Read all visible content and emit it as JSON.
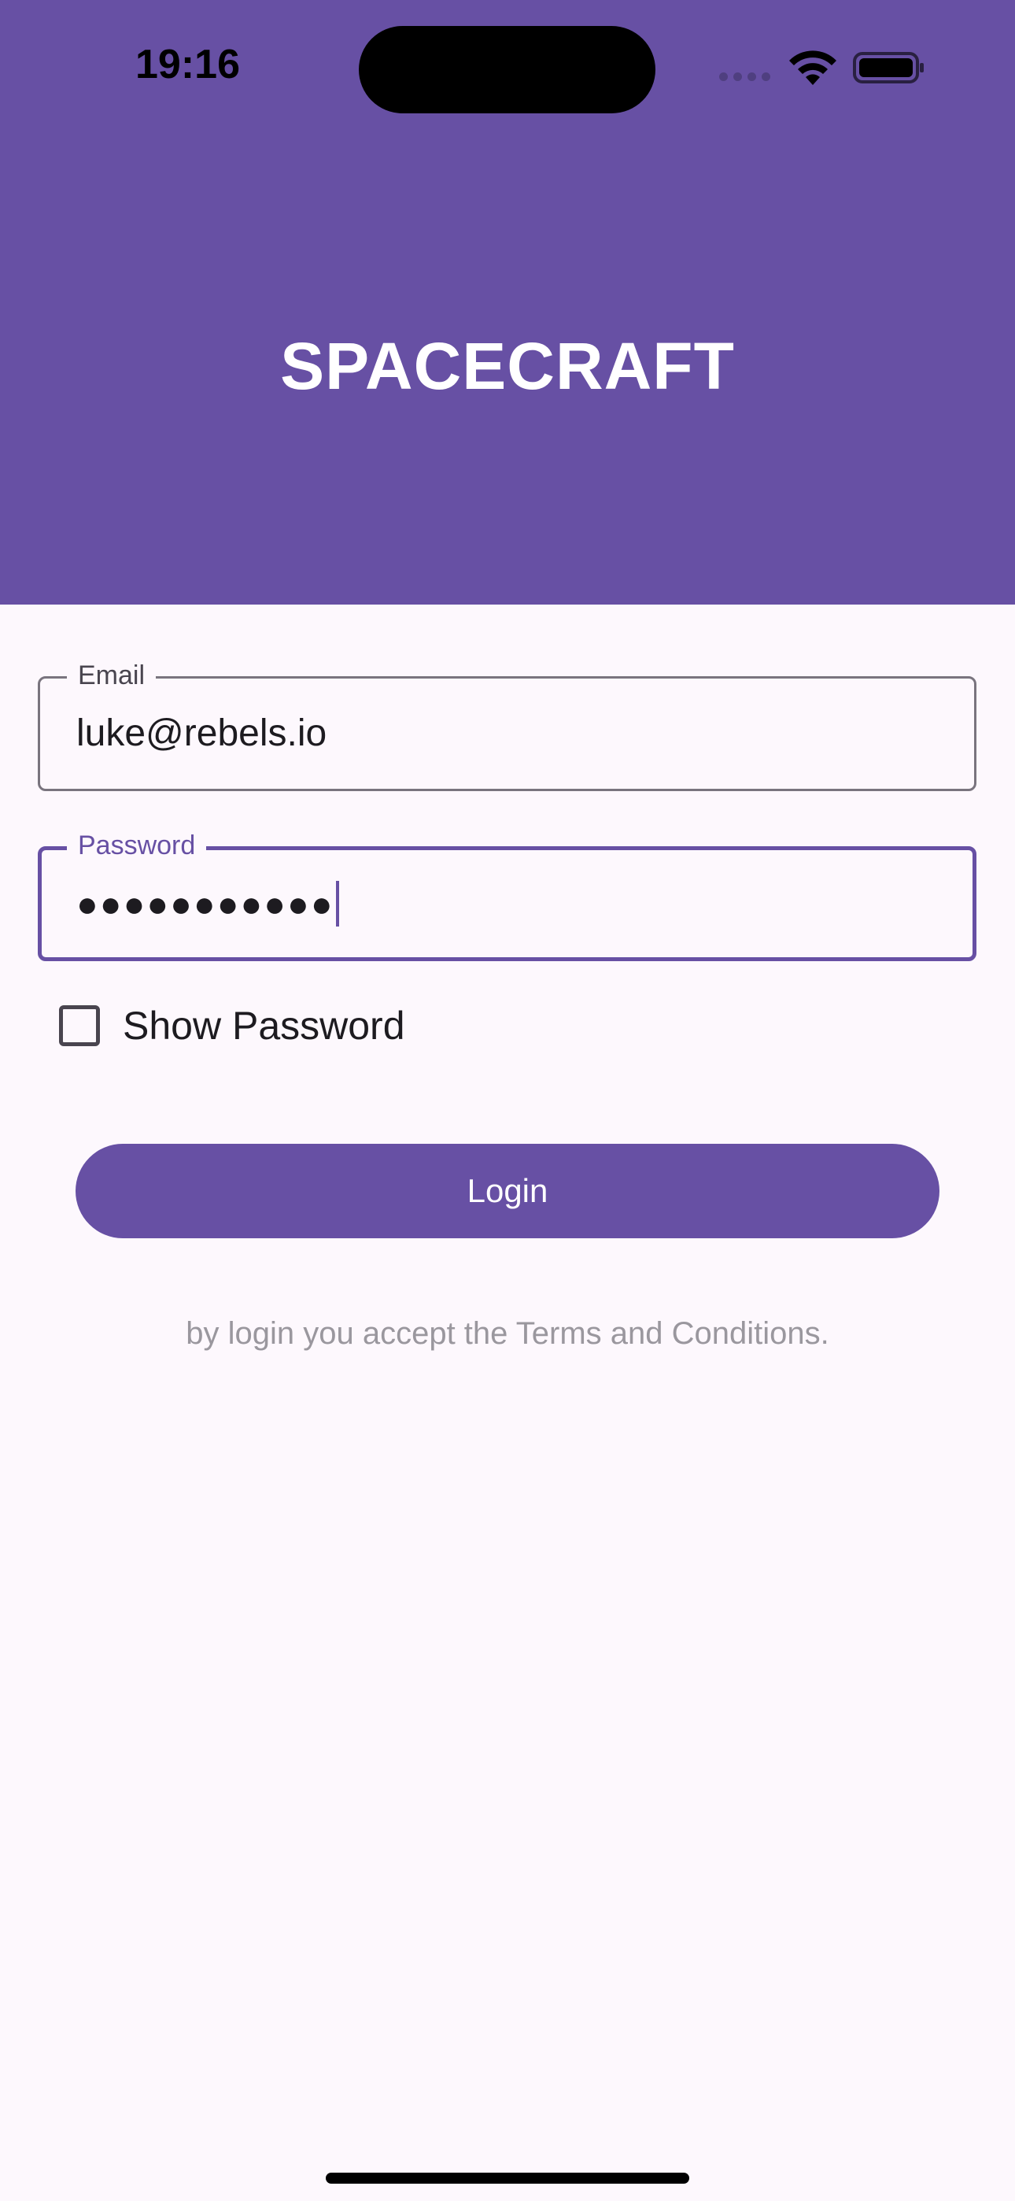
{
  "status_bar": {
    "time": "19:16"
  },
  "header": {
    "title": "SPACECRAFT",
    "color": "#6750A4"
  },
  "form": {
    "email": {
      "label": "Email",
      "value": "luke@rebels.io"
    },
    "password": {
      "label": "Password",
      "value": "●●●●●●●●●●●"
    },
    "show_password": {
      "label": "Show Password",
      "checked": false
    },
    "login_label": "Login",
    "terms_text": "by login you accept the Terms and Conditions."
  },
  "icons": {
    "signal": "cellular-signal-icon",
    "wifi": "wifi-icon",
    "battery": "battery-icon"
  }
}
